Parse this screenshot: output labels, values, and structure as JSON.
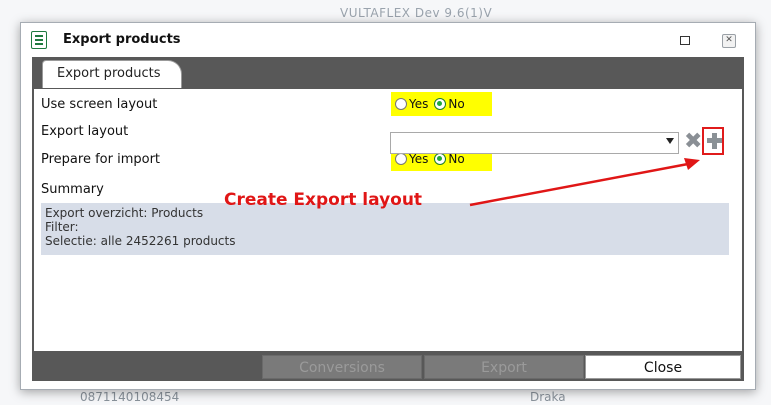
{
  "background": {
    "title": "VULTAFLEX Dev 9.6(1)V",
    "bottom_left": "0871140108454",
    "bottom_right": "Draka"
  },
  "dialog": {
    "title": "Export products",
    "tab_label": "Export products"
  },
  "form": {
    "use_screen_layout": {
      "label": "Use screen layout",
      "yes": "Yes",
      "no": "No",
      "selected": "No"
    },
    "export_layout": {
      "label": "Export layout",
      "value": ""
    },
    "prepare_for_import": {
      "label": "Prepare for import",
      "yes": "Yes",
      "no": "No",
      "selected": "No"
    },
    "summary_label": "Summary",
    "summary_lines": [
      "Export overzicht: Products",
      "Filter:",
      "Selectie: alle 2452261 products"
    ]
  },
  "annotation": {
    "text": "Create Export layout",
    "color": "#e01616"
  },
  "footer": {
    "conversions": "Conversions",
    "export": "Export",
    "close": "Close"
  },
  "colors": {
    "highlight": "#ffff00",
    "radio_selected": "#1fa83a",
    "summary_bg": "#d7dde8",
    "panel_dark": "#585858"
  },
  "icons": [
    "form-icon",
    "maximize-icon",
    "close-icon",
    "remove-icon",
    "add-icon",
    "dropdown-arrow-icon"
  ]
}
